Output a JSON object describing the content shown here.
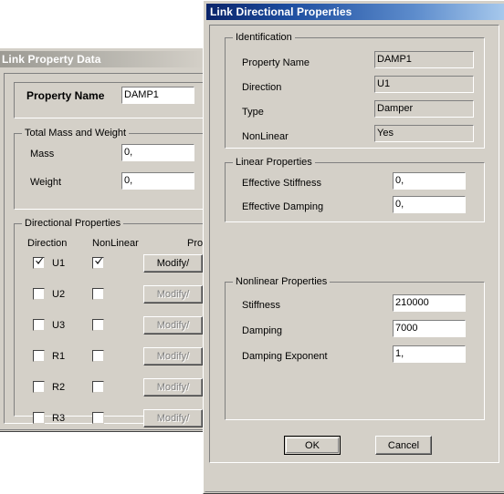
{
  "back_window": {
    "title": "Link Property Data",
    "property_name_label": "Property Name",
    "property_name_value": "DAMP1",
    "mass_weight_group": "Total Mass and Weight",
    "mass_label": "Mass",
    "mass_value": "0,",
    "weight_label": "Weight",
    "weight_value": "0,",
    "directional_group": "Directional Properties",
    "col_direction": "Direction",
    "col_nonlinear": "NonLinear",
    "col_properties": "Pro",
    "rows": [
      {
        "direction": "U1",
        "dir_checked": true,
        "nl_checked": true,
        "button": "Modify/",
        "enabled": true
      },
      {
        "direction": "U2",
        "dir_checked": false,
        "nl_checked": false,
        "button": "Modify/",
        "enabled": false
      },
      {
        "direction": "U3",
        "dir_checked": false,
        "nl_checked": false,
        "button": "Modify/",
        "enabled": false
      },
      {
        "direction": "R1",
        "dir_checked": false,
        "nl_checked": false,
        "button": "Modify/",
        "enabled": false
      },
      {
        "direction": "R2",
        "dir_checked": false,
        "nl_checked": false,
        "button": "Modify/",
        "enabled": false
      },
      {
        "direction": "R3",
        "dir_checked": false,
        "nl_checked": false,
        "button": "Modify/",
        "enabled": false
      }
    ]
  },
  "front_window": {
    "title": "Link Directional Properties",
    "identification": {
      "caption": "Identification",
      "property_name_label": "Property Name",
      "property_name_value": "DAMP1",
      "direction_label": "Direction",
      "direction_value": "U1",
      "type_label": "Type",
      "type_value": "Damper",
      "nonlinear_label": "NonLinear",
      "nonlinear_value": "Yes"
    },
    "linear": {
      "caption": "Linear Properties",
      "effective_stiffness_label": "Effective Stiffness",
      "effective_stiffness_value": "0,",
      "effective_damping_label": "Effective Damping",
      "effective_damping_value": "0,"
    },
    "nonlinear": {
      "caption": "Nonlinear Properties",
      "stiffness_label": "Stiffness",
      "stiffness_value": "210000",
      "damping_label": "Damping",
      "damping_value": "7000",
      "damping_exponent_label": "Damping Exponent",
      "damping_exponent_value": "1,"
    },
    "ok_label": "OK",
    "cancel_label": "Cancel"
  },
  "colors": {
    "dialog_face": "#d4d0c8",
    "active_title_start": "#0a246a",
    "active_title_end": "#a6c8ec",
    "inactive_title_start": "#9c9a93",
    "field_bg": "#ffffff",
    "disabled_text": "#808080"
  }
}
